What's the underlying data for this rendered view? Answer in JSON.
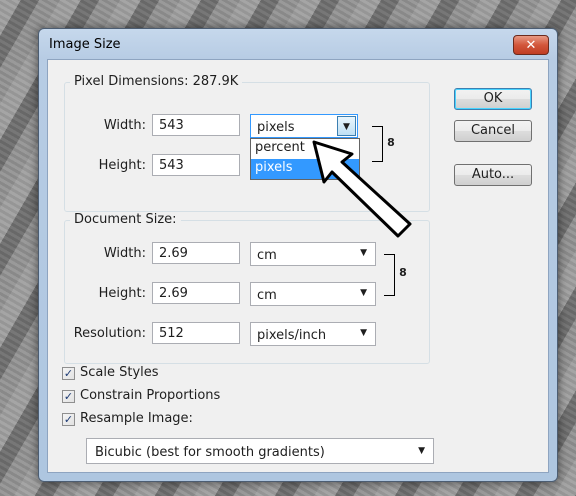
{
  "dialog": {
    "title": "Image Size",
    "close_glyph": "✕"
  },
  "pixel_dimensions": {
    "legend": "Pixel Dimensions:  287.9K",
    "width_label": "Width:",
    "width_value": "543",
    "width_unit": "pixels",
    "height_label": "Height:",
    "height_value": "543",
    "unit_options": [
      "percent",
      "pixels"
    ],
    "selected_option": "pixels"
  },
  "document_size": {
    "legend": "Document Size:",
    "width_label": "Width:",
    "width_value": "2.69",
    "width_unit": "cm",
    "height_label": "Height:",
    "height_value": "2.69",
    "height_unit": "cm",
    "resolution_label": "Resolution:",
    "resolution_value": "512",
    "resolution_unit": "pixels/inch"
  },
  "buttons": {
    "ok": "OK",
    "cancel": "Cancel",
    "auto": "Auto..."
  },
  "checkboxes": [
    {
      "label": "Scale Styles",
      "checked": true
    },
    {
      "label": "Constrain Proportions",
      "checked": true
    },
    {
      "label": "Resample Image:",
      "checked": true
    }
  ],
  "resample_method": "Bicubic (best for smooth gradients)",
  "icons": {
    "check": "✓",
    "dropdown_arrow": "▼",
    "chain": "8"
  }
}
